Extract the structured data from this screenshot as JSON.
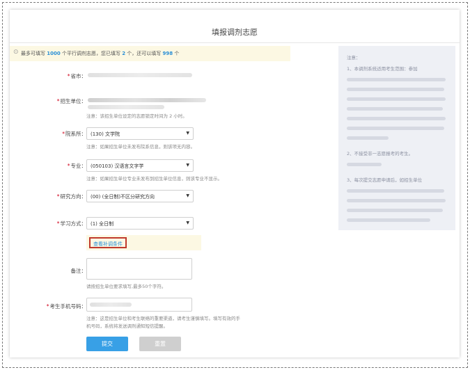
{
  "page": {
    "title": "填报调剂志愿"
  },
  "notice": {
    "prefix": "最多可填写",
    "max": "1000",
    "middle": "个平行调剂志愿，您已填写",
    "filled": "2",
    "middle2": "个，还可以填写",
    "remaining": "998",
    "suffix": "个"
  },
  "form": {
    "province": {
      "label": "省市："
    },
    "unit": {
      "label": "招生单位：",
      "hint": "注意：该招生单位设定的志愿锁定时间为"
    },
    "department": {
      "label": "院系所：",
      "value": "(130) 文学院",
      "hint": "注意：如果招生单位未发布院系信息，则该项无内容。"
    },
    "major": {
      "label": "专业：",
      "value": "(050103) 汉语言文字学",
      "hint": "注意：如果招生单位专业未发布到招生单位信息，则该专业不显示。"
    },
    "direction": {
      "label": "研究方向：",
      "value": "(00) (全日制)不区分研究方向"
    },
    "study_mode": {
      "label": "学习方式：",
      "value": "(1) 全日制"
    },
    "attachment_link": "查看补调条件",
    "remark": {
      "label": "备注：",
      "hint": "请按招生单位要求填写,最多50个字符。"
    },
    "phone": {
      "label": "考生手机号码：",
      "hint_line1": "注意：这是招生单位和考生联络的重要渠道，请考生谨慎填写。填写有效的手",
      "hint_line2": "机号码，系统将发送调剂通知短信提醒。"
    },
    "submit_label": "提交",
    "reset_label": "重置"
  },
  "sidebar": {
    "title": "注意：",
    "item1": "1、本调剂系统适用考生范围：参加",
    "item2": "2、不接受非一志愿报考的考生。",
    "item3": "3、每次提交志愿申请后，如招生单位"
  }
}
